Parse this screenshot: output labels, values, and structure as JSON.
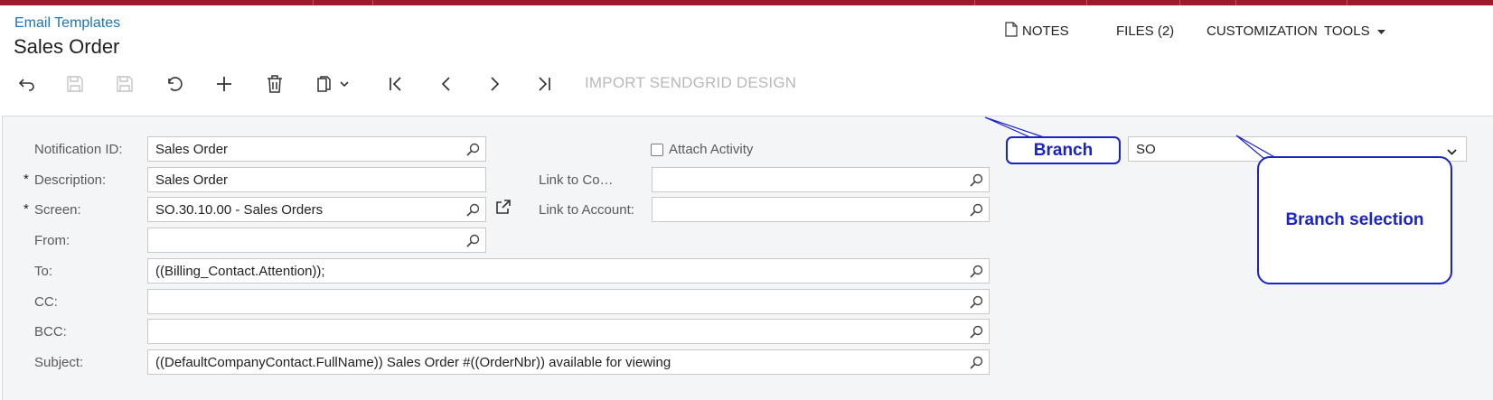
{
  "header": {
    "breadcrumb": "Email Templates",
    "title": "Sales Order"
  },
  "top_actions": {
    "notes": "NOTES",
    "files": "FILES (2)",
    "customization": "CUSTOMIZATION",
    "tools": "TOOLS"
  },
  "toolbar": {
    "buttons": [
      "back-icon",
      "save-close-icon",
      "save-icon",
      "undo-icon",
      "add-icon",
      "delete-icon",
      "copy-paste-icon",
      "first-record-icon",
      "previous-record-icon",
      "next-record-icon",
      "last-record-icon"
    ],
    "import_label": "IMPORT SENDGRID DESIGN"
  },
  "form": {
    "notification_id": {
      "label": "Notification ID:",
      "value": "Sales Order"
    },
    "description": {
      "label": "Description:",
      "value": "Sales Order",
      "required": "*"
    },
    "screen": {
      "label": "Screen:",
      "value": "SO.30.10.00 - Sales Orders",
      "required": "*"
    },
    "from": {
      "label": "From:",
      "value": ""
    },
    "to": {
      "label": "To:",
      "value": "((Billing_Contact.Attention));"
    },
    "cc": {
      "label": "CC:",
      "value": ""
    },
    "bcc": {
      "label": "BCC:",
      "value": ""
    },
    "subject": {
      "label": "Subject:",
      "value": "((DefaultCompanyContact.FullName)) Sales Order #((OrderNbr)) available for viewing"
    },
    "attach_activity": {
      "label": "Attach Activity",
      "checked": false
    },
    "link_to_contact": {
      "label": "Link to Co…",
      "value": ""
    },
    "link_to_account": {
      "label": "Link to Account:",
      "value": ""
    },
    "branch": {
      "value": "SO"
    }
  },
  "callouts": {
    "branch": "Branch",
    "branch_selection": "Branch selection",
    "color": "#1a23c8"
  },
  "colors": {
    "topbar": "#9b1c2a",
    "link": "#1b75bb",
    "panel": "#f4f5f6"
  }
}
